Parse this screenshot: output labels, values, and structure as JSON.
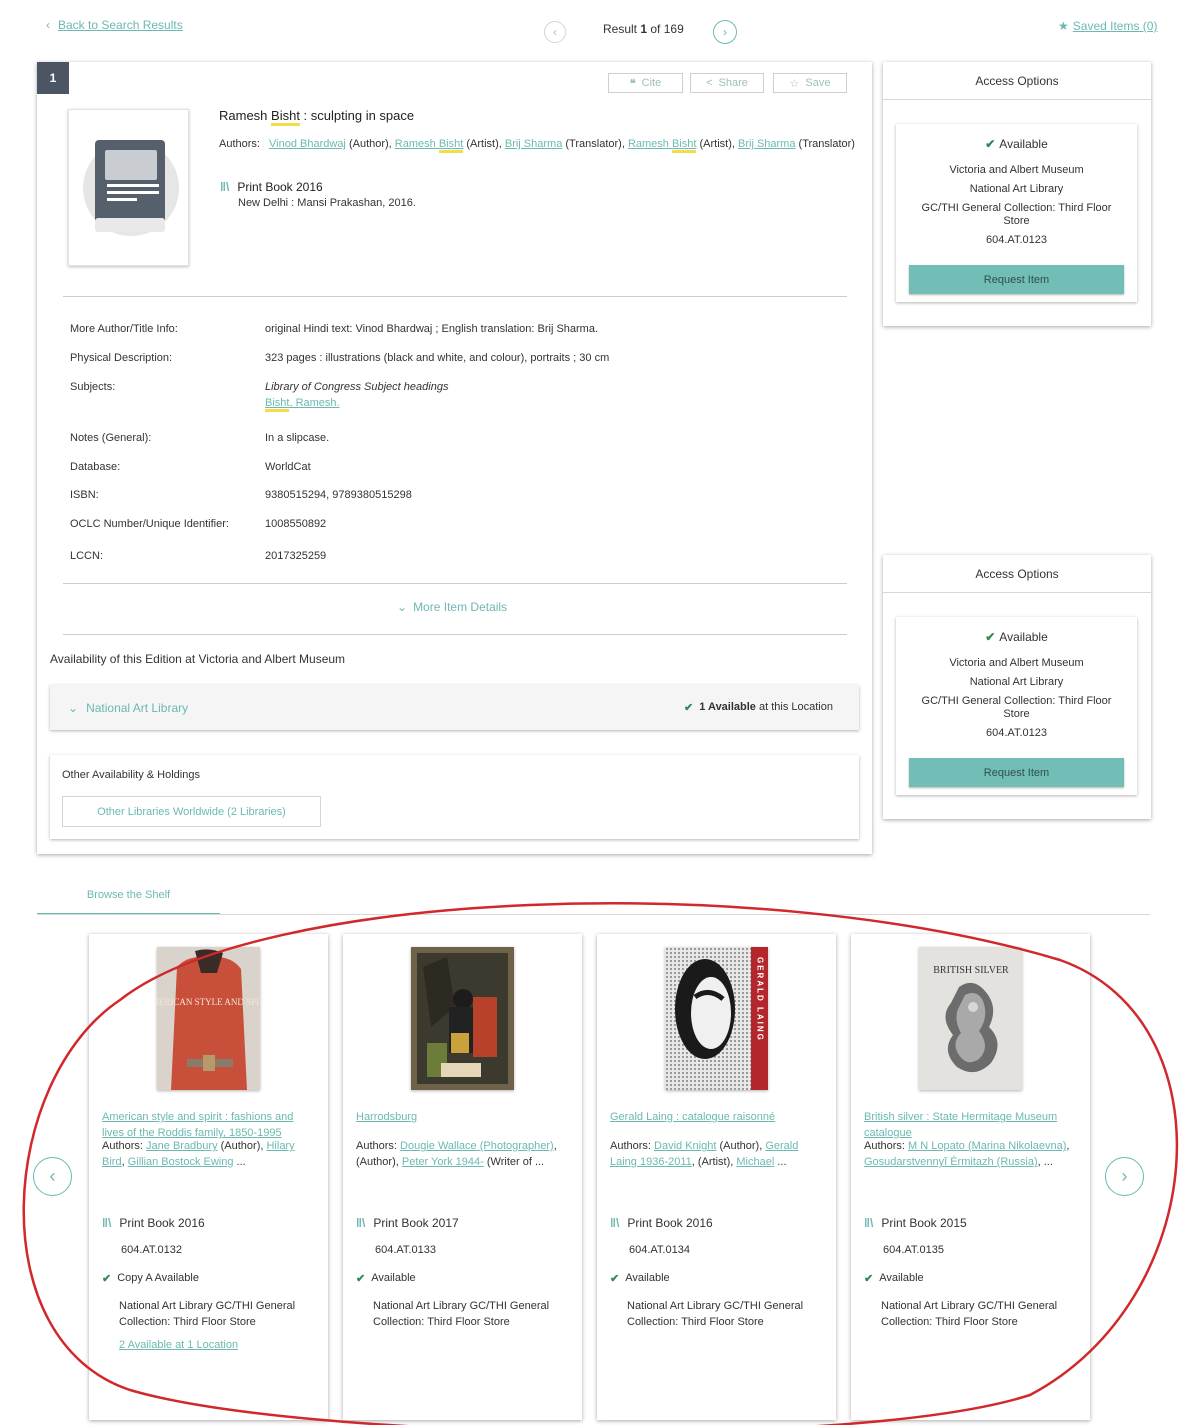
{
  "nav": {
    "back_label": "Back to Search Results",
    "result_prefix": "Result ",
    "result_current": "1",
    "result_suffix": " of 169",
    "saved_label": "Saved Items (0)"
  },
  "record": {
    "number": "1",
    "tools": {
      "cite": "Cite",
      "share": "Share",
      "save": "Save"
    },
    "title_pre": "Ramesh ",
    "title_hl": "Bisht",
    "title_post": " : sculpting in space",
    "authors_label": "Authors:",
    "authors": [
      {
        "name": "Vinod Bhardwaj",
        "name_hl": "",
        "role": " (Author), "
      },
      {
        "name": "Ramesh ",
        "name_hl": "Bisht",
        "role": " (Artist), "
      },
      {
        "name": "Brij Sharma",
        "name_hl": "",
        "role": " (Translator), "
      },
      {
        "name": "Ramesh ",
        "name_hl": "Bisht",
        "role": " (Artist), "
      },
      {
        "name": "Brij Sharma",
        "name_hl": "",
        "role": " (Translator)"
      }
    ],
    "format": "Print Book 2016",
    "publisher": "New Delhi : Mansi Prakashan, 2016.",
    "details": [
      {
        "label": "More Author/Title Info:",
        "value": "original Hindi text: Vinod Bhardwaj ; English translation: Brij Sharma."
      },
      {
        "label": "Physical Description:",
        "value": "323 pages : illustrations (black and white, and colour), portraits ; 30 cm"
      },
      {
        "label": "Subjects:",
        "value": "Library of Congress Subject headings",
        "link_hl": "Bisht",
        "link_rest": ", Ramesh."
      },
      {
        "label": "Notes (General):",
        "value": "In a slipcase."
      },
      {
        "label": "Database:",
        "value": "WorldCat"
      },
      {
        "label": "ISBN:",
        "value": "9380515294, 9789380515298"
      },
      {
        "label": "OCLC Number/Unique Identifier:",
        "value": "1008550892"
      },
      {
        "label": "LCCN:",
        "value": "2017325259"
      }
    ],
    "more_details": "More Item Details",
    "availability_heading": "Availability of this Edition at Victoria and Albert Museum",
    "location_name": "National Art Library",
    "location_avail_bold": "1 Available",
    "location_avail_rest": " at this Location",
    "other_heading": "Other Availability & Holdings",
    "other_button": "Other Libraries Worldwide (2 Libraries)"
  },
  "access": {
    "title": "Access Options",
    "status": "Available",
    "institution": "Victoria and Albert Museum",
    "library": "National Art Library",
    "collection_line1": "GC/THI General Collection: Third Floor",
    "collection_line2": "Store",
    "call_number": "604.AT.0123",
    "request_button": "Request Item"
  },
  "shelf": {
    "tab_label": "Browse the Shelf",
    "items": [
      {
        "title": "American style and spirit : fashions and lives of the Roddis family, 1850-1995",
        "authors_prefix": "Authors: ",
        "authors_html": [
          {
            "t": "Jane Bradbury",
            "link": true
          },
          {
            "t": " (Author), ",
            "link": false
          },
          {
            "t": "Hilary Bird",
            "link": true
          },
          {
            "t": ", ",
            "link": false
          },
          {
            "t": "Gillian Bostock Ewing",
            "link": true
          },
          {
            "t": " ...",
            "link": false
          }
        ],
        "format": "Print Book 2016",
        "call_number": "604.AT.0132",
        "availability": "Copy A Available",
        "location": "National Art Library GC/THI General Collection: Third Floor Store",
        "more": "2 Available at 1 Location",
        "cover_text": "AMERICAN STYLE AND SPIRIT"
      },
      {
        "title": "Harrodsburg",
        "authors_prefix": "Authors: ",
        "authors_html": [
          {
            "t": "Dougie Wallace (Photographer)",
            "link": true
          },
          {
            "t": ", (Author), ",
            "link": false
          },
          {
            "t": "Peter York 1944-",
            "link": true
          },
          {
            "t": " (Writer of ...",
            "link": false
          }
        ],
        "format": "Print Book 2017",
        "call_number": "604.AT.0133",
        "availability": "Available",
        "location": "National Art Library GC/THI General Collection: Third Floor Store",
        "more": "",
        "cover_text": ""
      },
      {
        "title": "Gerald Laing : catalogue raisonné",
        "authors_prefix": "Authors: ",
        "authors_html": [
          {
            "t": "David Knight",
            "link": true
          },
          {
            "t": " (Author), ",
            "link": false
          },
          {
            "t": "Gerald Laing 1936-2011",
            "link": true
          },
          {
            "t": ", (Artist), ",
            "link": false
          },
          {
            "t": "Michael",
            "link": true
          },
          {
            "t": " ...",
            "link": false
          }
        ],
        "format": "Print Book 2016",
        "call_number": "604.AT.0134",
        "availability": "Available",
        "location": "National Art Library GC/THI General Collection: Third Floor Store",
        "more": "",
        "cover_text": "GERALD LAING"
      },
      {
        "title": "British silver : State Hermitage Museum catalogue",
        "authors_prefix": "Authors: ",
        "authors_html": [
          {
            "t": "M N Lopato (Marina Nikolaevna)",
            "link": true
          },
          {
            "t": ", ",
            "link": false
          },
          {
            "t": "Gosudarstvennyĭ Ėrmitazh (Russia)",
            "link": true
          },
          {
            "t": ", ...",
            "link": false
          }
        ],
        "format": "Print Book 2015",
        "call_number": "604.AT.0135",
        "availability": "Available",
        "location": "National Art Library GC/THI General Collection: Third Floor Store",
        "more": "",
        "cover_text": "BRITISH SILVER"
      }
    ]
  },
  "colors": {
    "accent": "#6bb9b2",
    "button": "#72bdb5",
    "badge": "#4b5563",
    "available": "#2e8b57",
    "annotation": "#d0282b",
    "highlight": "#f2dd4a"
  },
  "icons": {
    "back": "chevron-left-icon",
    "saved": "star-icon",
    "cite": "quote-icon",
    "share": "share-icon",
    "save": "star-outline-icon",
    "format": "book-library-icon",
    "available": "checkmark-icon",
    "expand": "chevron-down-icon"
  }
}
